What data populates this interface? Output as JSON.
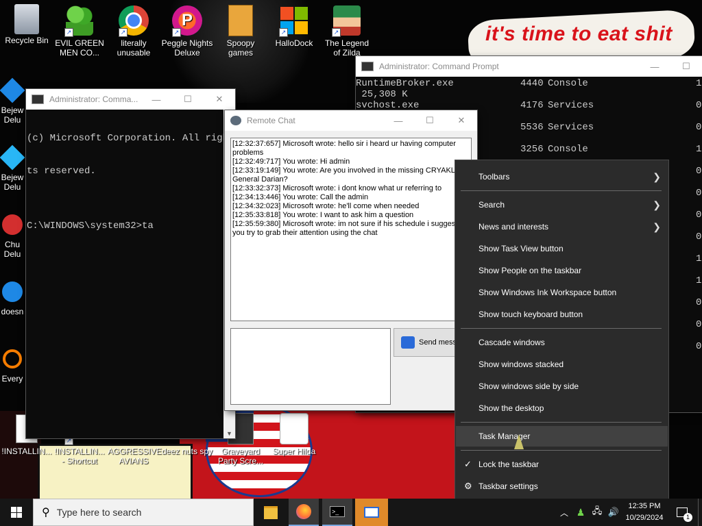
{
  "wallpaper": {
    "banner_text": "it's time to eat shit"
  },
  "desktop_icons": [
    {
      "label": "Recycle Bin",
      "glyph": "🗑"
    },
    {
      "label": "EVIL GREEN MEN CO...",
      "glyph": "👥"
    },
    {
      "label": "literally unusable",
      "glyph": "◉"
    },
    {
      "label": "Peggle Nights Deluxe",
      "glyph": "P"
    },
    {
      "label": "Spoopy games",
      "glyph": "📁"
    },
    {
      "label": "HalloDock",
      "glyph": "⊞"
    },
    {
      "label": "The Legend of Zilda",
      "glyph": "☺"
    },
    {
      "label": "!INSTALLIN...",
      "glyph": "≡"
    },
    {
      "label": "!INSTALLIN... - Shortcut",
      "glyph": "≡"
    },
    {
      "label": "AGGRESSIVE AVIANS",
      "glyph": "●"
    },
    {
      "label": "deez nuts spy",
      "glyph": "♣"
    },
    {
      "label": "Graveyard Party Scre...",
      "glyph": "⚑"
    },
    {
      "label": "Super Hilda",
      "glyph": "☻"
    }
  ],
  "partial_icons": [
    "Bejew Delu",
    "Bejew Delu",
    "Chu Delu",
    "doesn",
    "Every"
  ],
  "cmd_left": {
    "title": "Administrator: Comma...",
    "lines": [
      "(c) Microsoft Corporation. All righ",
      "ts reserved.",
      "",
      "C:\\WINDOWS\\system32>ta"
    ]
  },
  "cmd_right": {
    "title": "Administrator: Command Prompt",
    "rows": [
      {
        "name": "RuntimeBroker.exe",
        "pid": "4440",
        "session": "Console",
        "n": "1"
      },
      {
        "name": " 25,308 K",
        "pid": "",
        "session": "",
        "n": ""
      },
      {
        "name": "svchost.exe",
        "pid": "4176",
        "session": "Services",
        "n": "0"
      },
      {
        "name": "",
        "pid": "5536",
        "session": "Services",
        "n": "0"
      },
      {
        "name": "",
        "pid": "3256",
        "session": "Console",
        "n": "1"
      }
    ],
    "right_col": [
      "1",
      "0",
      "0",
      "1",
      "0",
      "0",
      "0",
      "0",
      "1",
      "1",
      "0",
      "0",
      "0"
    ]
  },
  "remote_chat": {
    "title": "Remote Chat",
    "messages": [
      "[12:32:37:657] Microsoft wrote: hello sir i heard ur having computer problems",
      "[12:32:49:717] You wrote: Hi admin",
      "[12:33:19:149] You wrote: Are you involved in the missing CRYAKL General Darian?",
      "[12:33:32:373] Microsoft wrote: i dont know what ur referring to",
      "[12:34:13:446] You wrote: Call the admin",
      "[12:34:32:023] Microsoft wrote: he'll come when needed",
      "[12:35:33:818] You wrote: I want to ask him a question",
      "[12:35:59:380] Microsoft wrote: im not sure if his schedule i sugges you try to grab their attention using the chat"
    ],
    "send_label": "Send mess"
  },
  "context_menu": {
    "toolbars": "Toolbars",
    "search": "Search",
    "news": "News and interests",
    "task_view": "Show Task View button",
    "people": "Show People on the taskbar",
    "ink": "Show Windows Ink Workspace button",
    "touch_kb": "Show touch keyboard button",
    "cascade": "Cascade windows",
    "stacked": "Show windows stacked",
    "side_by_side": "Show windows side by side",
    "desktop": "Show the desktop",
    "task_manager": "Task Manager",
    "lock": "Lock the taskbar",
    "settings": "Taskbar settings"
  },
  "taskbar": {
    "search_placeholder": "Type here to search",
    "time": "12:35 PM",
    "date": "10/29/2024",
    "notification_count": "1"
  },
  "colors": {
    "accent_blue": "#0078d7",
    "menu_bg": "#2b2b2b",
    "taskbar_bg": "#161616",
    "chat_bg": "#f0f0f0"
  }
}
